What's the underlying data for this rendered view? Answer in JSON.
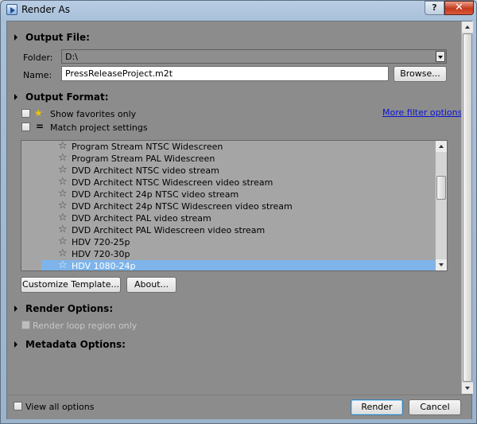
{
  "window": {
    "title": "Render As",
    "help_label": "?",
    "close_label": "✕"
  },
  "output_file": {
    "header": "Output File:",
    "folder_label": "Folder:",
    "folder_value": "D:\\",
    "name_label": "Name:",
    "name_value": "PressReleaseProject.m2t",
    "browse_label": "Browse..."
  },
  "output_format": {
    "header": "Output Format:",
    "show_favorites_label": "Show favorites only",
    "match_project_label": "Match project settings",
    "more_filter_link": "More filter options",
    "templates": [
      {
        "label": "Program Stream NTSC Widescreen",
        "selected": false
      },
      {
        "label": "Program Stream PAL Widescreen",
        "selected": false
      },
      {
        "label": "DVD Architect NTSC video stream",
        "selected": false
      },
      {
        "label": "DVD Architect NTSC Widescreen video stream",
        "selected": false
      },
      {
        "label": "DVD Architect 24p NTSC video stream",
        "selected": false
      },
      {
        "label": "DVD Architect 24p NTSC Widescreen video stream",
        "selected": false
      },
      {
        "label": "DVD Architect PAL video stream",
        "selected": false
      },
      {
        "label": "DVD Architect PAL Widescreen video stream",
        "selected": false
      },
      {
        "label": "HDV 720-25p",
        "selected": false
      },
      {
        "label": "HDV 720-30p",
        "selected": false
      },
      {
        "label": "HDV 1080-24p",
        "selected": true
      }
    ],
    "customize_label": "Customize Template...",
    "about_label": "About..."
  },
  "render_options": {
    "header": "Render Options:",
    "loop_region_label": "Render loop region only"
  },
  "metadata_options": {
    "header": "Metadata Options:"
  },
  "footer": {
    "view_all_label": "View all options",
    "render_label": "Render",
    "cancel_label": "Cancel"
  }
}
